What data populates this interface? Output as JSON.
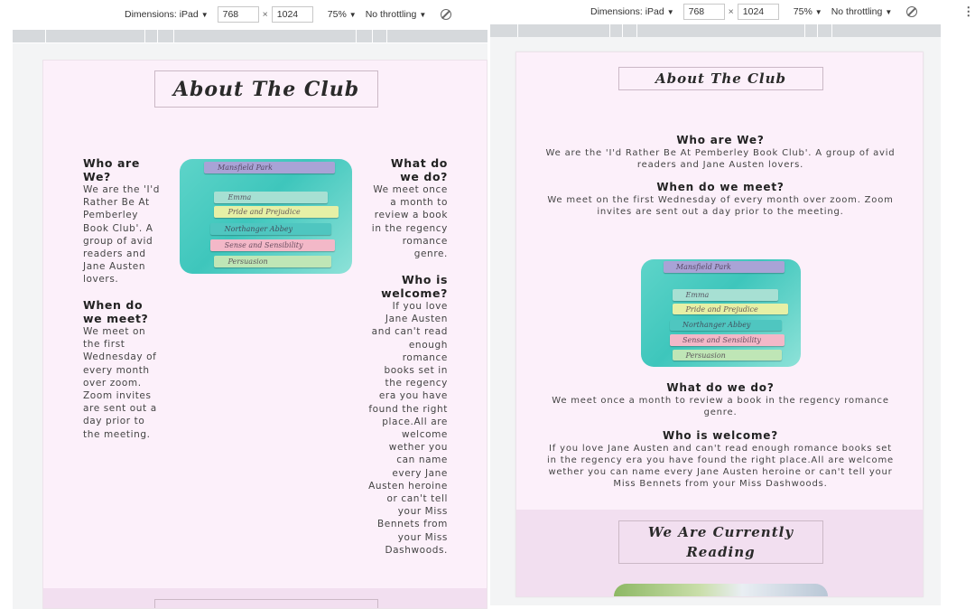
{
  "devtools": {
    "dimensions_label": "Dimensions: iPad",
    "width_value": "768",
    "times": "×",
    "height_value": "1024",
    "zoom": "75%",
    "throttling": "No throttling",
    "caret": "▼",
    "more_icon": "⋮"
  },
  "club": {
    "about_title": "About The Club",
    "reading_title": "We Are Currently Reading",
    "sections": {
      "who": {
        "heading": "Who are We?",
        "text": "We are the 'I'd Rather Be At Pemberley Book Club'. A group of avid readers and Jane Austen lovers."
      },
      "when": {
        "heading": "When do we meet?",
        "text": "We meet on the first Wednesday of every month over zoom. Zoom invites are sent out a day prior to the meeting."
      },
      "what": {
        "heading": "What do we do?",
        "text": "We meet once a month to review a book in the regency romance genre."
      },
      "welcome": {
        "heading": "Who is welcome?",
        "text": "If you love Jane Austen and can't read enough romance books set in the regency era you have found the right place.All are welcome wether you can name every Jane Austen heroine or can't tell your Miss Bennets from your Miss Dashwoods."
      }
    },
    "books": [
      {
        "title": "Mansfield Park",
        "color": "#a9a3d6"
      },
      {
        "title": "Emma",
        "color": "#a7e0d3"
      },
      {
        "title": "Pride and Prejudice",
        "color": "#e6f0a6"
      },
      {
        "title": "Northanger Abbey",
        "color": "#4fc6c0"
      },
      {
        "title": "Sense and Sensibility",
        "color": "#f3b8c8"
      },
      {
        "title": "Persuasion",
        "color": "#bfe6b6"
      }
    ]
  },
  "colors": {
    "page_bg": "#fcf0fa",
    "band_bg": "#f2dff0",
    "title_border": "#cbb8c6"
  }
}
